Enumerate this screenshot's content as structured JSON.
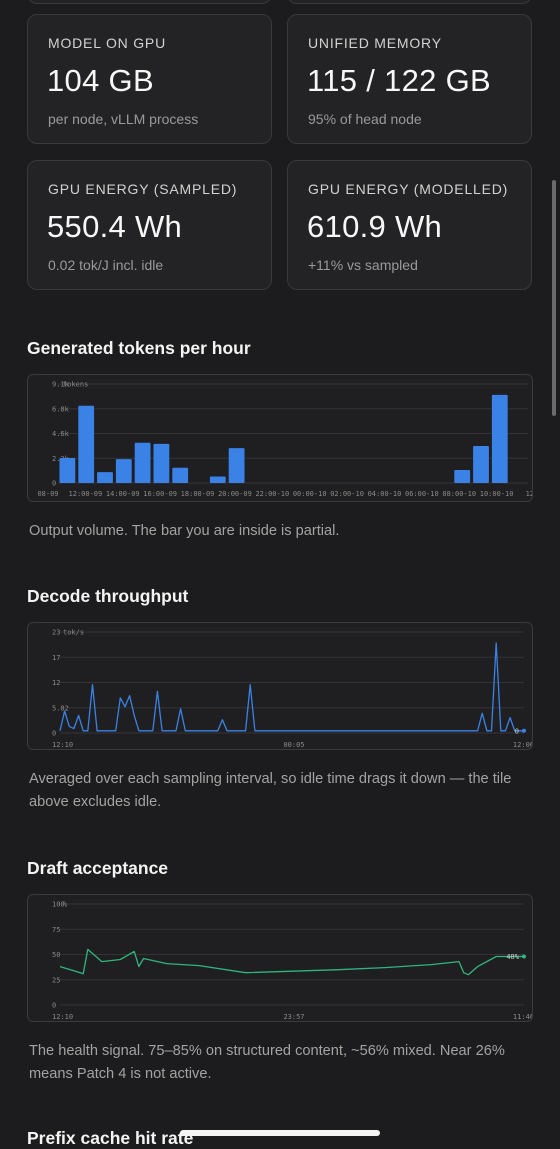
{
  "stats": [
    {
      "label": "MODEL ON GPU",
      "value": "104 GB",
      "sub": "per node, vLLM process"
    },
    {
      "label": "UNIFIED MEMORY",
      "value": "115 / 122 GB",
      "sub": "95% of head node"
    },
    {
      "label": "GPU ENERGY (SAMPLED)",
      "value": "550.4 Wh",
      "sub": "0.02 tok/J incl. idle"
    },
    {
      "label": "GPU ENERGY (MODELLED)",
      "value": "610.9 Wh",
      "sub": "+11% vs sampled"
    }
  ],
  "sections": {
    "tokens": {
      "title": "Generated tokens per hour",
      "caption": "Output volume. The bar you are inside is partial."
    },
    "decode": {
      "title": "Decode throughput",
      "caption": "Averaged over each sampling interval, so idle time drags it down — the tile above excludes idle."
    },
    "draft": {
      "title": "Draft acceptance",
      "caption": "The health signal. 75–85% on structured content, ~56% mixed. Near 26% means Patch 4 is not active."
    },
    "prefix": {
      "title": "Prefix cache hit rate"
    }
  },
  "colors": {
    "bar": "#3b82e6",
    "line_blue": "#3b82e6",
    "line_green": "#2fb67c",
    "grid": "#343437",
    "tick": "#8a8a8a"
  },
  "chart_data": [
    {
      "type": "bar",
      "unit_label": "tokens",
      "yticks": [
        "0",
        "2.3k",
        "4.6k",
        "6.8k",
        "9.1k"
      ],
      "ylim": [
        0,
        9100
      ],
      "xtick_labels": [
        "08-09",
        "12:00-09",
        "14:00-09",
        "16:00-09",
        "18:00-09",
        "20:00-09",
        "22:00-10",
        "00:00-10",
        "02:00-10",
        "04:00-10",
        "06:00-10",
        "08:00-10",
        "10:00-10",
        "12:0"
      ],
      "values": [
        2300,
        7100,
        1000,
        2200,
        3700,
        3600,
        1400,
        0,
        600,
        3200,
        0,
        0,
        0,
        0,
        0,
        0,
        0,
        0,
        0,
        0,
        0,
        1200,
        3400,
        8100,
        0
      ],
      "grid": true
    },
    {
      "type": "line",
      "unit_label": "tok/s",
      "yticks": [
        "0",
        "5.82",
        "12",
        "17",
        "23"
      ],
      "ylim": [
        0,
        23
      ],
      "xtick_labels": [
        "12:10",
        "00:05",
        "12:06"
      ],
      "x": [
        0,
        1,
        2,
        3,
        4,
        5,
        6,
        7,
        8,
        9,
        10,
        11,
        12,
        13,
        14,
        15,
        16,
        17,
        18,
        19,
        20,
        21,
        22,
        23,
        24,
        25,
        26,
        27,
        28,
        29,
        30,
        31,
        32,
        33,
        34,
        35,
        36,
        37,
        38,
        39,
        40,
        41,
        42,
        43,
        44,
        45,
        46,
        47,
        48,
        49,
        50,
        51,
        52,
        53,
        54,
        55,
        56,
        57,
        58,
        59,
        60,
        61,
        62,
        63,
        64,
        65,
        66,
        67,
        68,
        69,
        70,
        71,
        72,
        73,
        74,
        75,
        76,
        77,
        78,
        79,
        80,
        81,
        82,
        83,
        84,
        85,
        86,
        87,
        88,
        89,
        90,
        91,
        92,
        93,
        94,
        95,
        96,
        97,
        98,
        99,
        100
      ],
      "values": [
        0.5,
        5,
        1.5,
        1,
        4,
        0.5,
        0.5,
        11,
        0.5,
        0.5,
        0.5,
        0.5,
        0.5,
        8,
        6,
        8.5,
        4,
        0.5,
        0.5,
        0.5,
        0.5,
        9.5,
        0.5,
        0.5,
        0.5,
        0.5,
        5.5,
        0.5,
        0.5,
        0.5,
        0.5,
        0.5,
        0.5,
        0.5,
        0.5,
        3,
        0.5,
        0.5,
        0.5,
        0.5,
        0.5,
        11,
        0.5,
        0.5,
        0.5,
        0.5,
        0.5,
        0.5,
        0.5,
        0.5,
        0.5,
        0.5,
        0.5,
        0.5,
        0.5,
        0.5,
        0.5,
        0.5,
        0.5,
        0.5,
        0.5,
        0.5,
        0.5,
        0.5,
        0.5,
        0.5,
        0.5,
        0.5,
        0.5,
        0.5,
        0.5,
        0.5,
        0.5,
        0.5,
        0.5,
        0.5,
        0.5,
        0.5,
        0.5,
        0.5,
        0.5,
        0.5,
        0.5,
        0.5,
        0.5,
        0.5,
        0.5,
        0.5,
        0.5,
        0.5,
        0.5,
        4.5,
        0.5,
        0.5,
        20.5,
        0.5,
        0.5,
        3.5,
        0.5,
        0.5,
        0.5
      ],
      "last_value_label": "0",
      "grid": true
    },
    {
      "type": "line",
      "unit_label": "%",
      "yticks": [
        "0",
        "25",
        "50",
        "75",
        "100"
      ],
      "ylim": [
        0,
        100
      ],
      "xtick_labels": [
        "12:10",
        "23:57",
        "11:46"
      ],
      "x": [
        0,
        3,
        5,
        6,
        9,
        13,
        16,
        17,
        18,
        23,
        30,
        40,
        60,
        70,
        80,
        86,
        87,
        88,
        90,
        94,
        97,
        100
      ],
      "values": [
        38,
        34,
        31,
        55,
        43,
        45,
        53,
        38,
        46,
        41,
        39,
        32,
        35,
        37,
        40,
        43,
        32,
        30,
        38,
        48,
        48,
        48
      ],
      "last_value_label": "48%",
      "grid": true
    }
  ]
}
